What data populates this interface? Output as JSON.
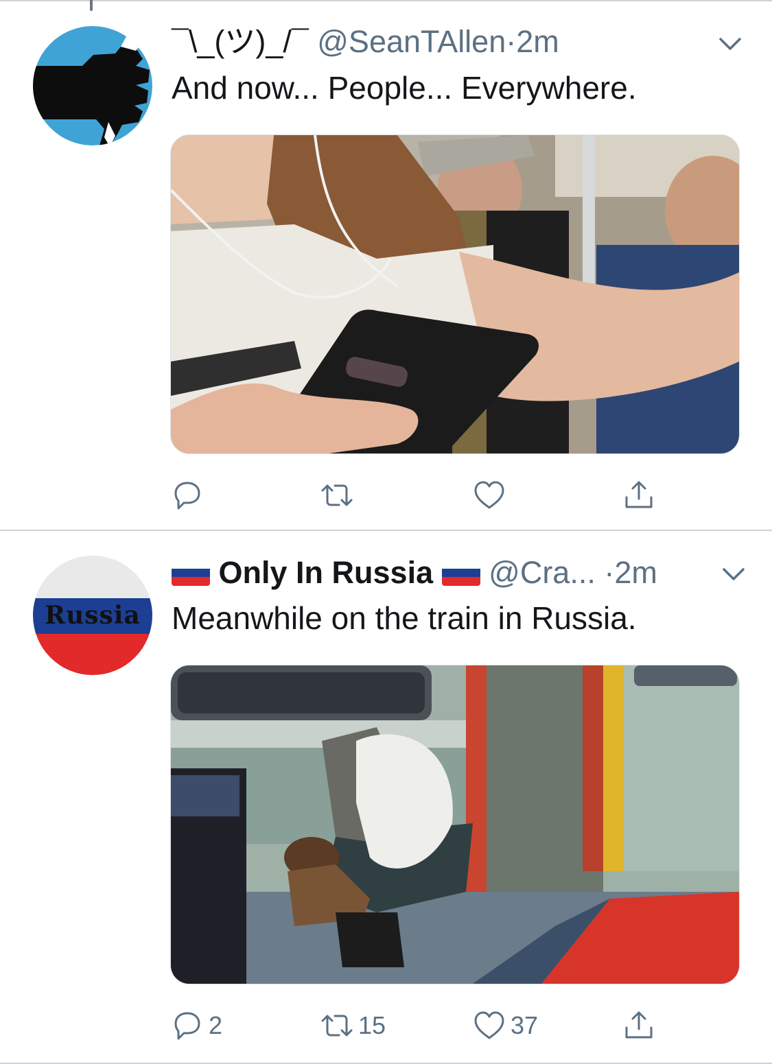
{
  "tweets": [
    {
      "display_name": "¯\\_(ツ)_/¯",
      "handle": "@SeanTAllen",
      "separator": "·",
      "time": "2m",
      "text": "And now... People... Everywhere.",
      "avatar_icon": "thumbs-down-fist-icon",
      "media_description_icon": "subway-crowd-photo",
      "actions": {
        "reply_count": "",
        "retweet_count": "",
        "like_count": ""
      }
    },
    {
      "display_name": "Only In Russia",
      "handle": "@Cra...",
      "separator": "·",
      "time": "2m",
      "text": "Meanwhile on the train in Russia.",
      "avatar_text": "Russia",
      "flag_icon": "russia-flag-icon",
      "media_description_icon": "train-seat-sleeper-photo",
      "actions": {
        "reply_count": "2",
        "retweet_count": "15",
        "like_count": "37"
      }
    }
  ],
  "colors": {
    "secondary_text": "#5b7083",
    "primary_text": "#14171a",
    "avatar1_bg": "#3fa3d6",
    "flag_white": "#ffffff",
    "flag_blue": "#1c3f94",
    "flag_red": "#e22a2a"
  }
}
